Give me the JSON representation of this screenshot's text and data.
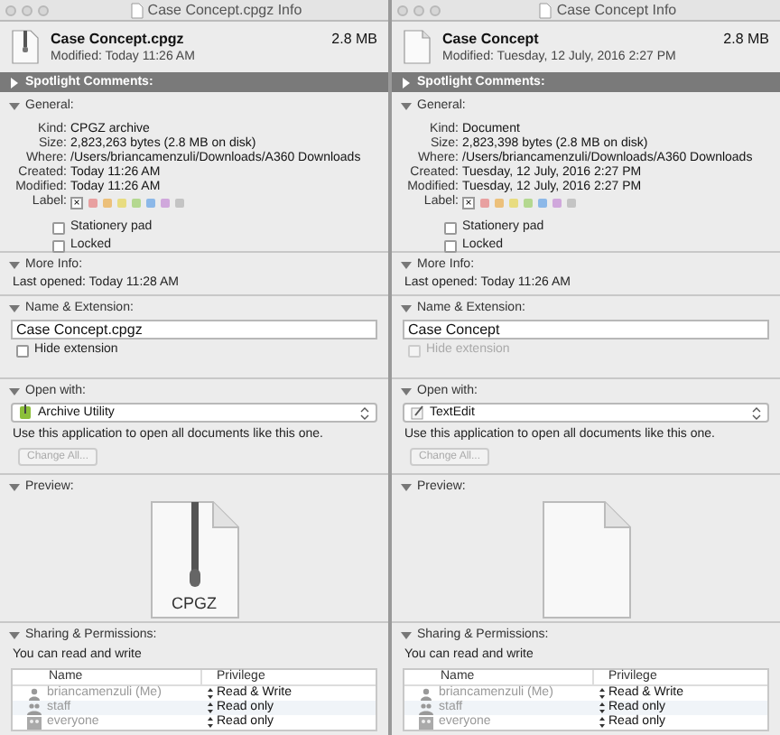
{
  "windows": [
    {
      "title": "Case Concept.cpgz Info",
      "file": {
        "name": "Case Concept.cpgz",
        "size": "2.8 MB",
        "modified": "Modified: Today 11:26 AM",
        "kind": "archive"
      },
      "spotlight": {
        "label": "Spotlight Comments:",
        "expanded": false
      },
      "general": {
        "label": "General:",
        "expanded": true,
        "fields": [
          {
            "key": "Kind:",
            "value": "CPGZ archive"
          },
          {
            "key": "Size:",
            "value": "2,823,263 bytes (2.8 MB on disk)"
          },
          {
            "key": "Where:",
            "value": "/Users/briancamenzuli/Downloads/A360 Downloads"
          },
          {
            "key": "Created:",
            "value": "Today 11:26 AM"
          },
          {
            "key": "Modified:",
            "value": "Today 11:26 AM"
          }
        ],
        "label_key": "Label:",
        "label_none": "×",
        "label_colors": [
          {
            "color": "#e8a0a0"
          },
          {
            "color": "#ecc07a"
          },
          {
            "color": "#e8dc80"
          },
          {
            "color": "#b4d890"
          },
          {
            "color": "#8cb8e8"
          },
          {
            "color": "#d0a8dc"
          },
          {
            "color": "#c4c4c4"
          }
        ],
        "stationery": {
          "label": "Stationery pad",
          "checked": false
        },
        "locked": {
          "label": "Locked",
          "checked": false
        }
      },
      "more_info": {
        "label": "More Info:",
        "expanded": true,
        "last_opened": "Last opened: Today 11:28 AM"
      },
      "name_ext": {
        "label": "Name & Extension:",
        "expanded": true,
        "value": "Case Concept.cpgz",
        "hide_extension": {
          "label": "Hide extension",
          "checked": false,
          "disabled": false
        }
      },
      "open_with": {
        "label": "Open with:",
        "expanded": true,
        "app": {
          "kind": "archive",
          "label": "Archive Utility"
        },
        "note": "Use this application to open all documents like this one.",
        "button": {
          "label": "Change All...",
          "disabled": true
        }
      },
      "preview": {
        "label": "Preview:",
        "expanded": true,
        "kind": "archive",
        "badge": "CPGZ"
      },
      "sharing": {
        "label": "Sharing & Permissions:",
        "expanded": true,
        "note": "You can read and write",
        "columns": [
          "Name",
          "Privilege"
        ],
        "rows": [
          {
            "kind": "user",
            "name": "briancamenzuli (Me)",
            "privilege": "Read & Write"
          },
          {
            "kind": "group",
            "name": "staff",
            "privilege": "Read only"
          },
          {
            "kind": "everyone",
            "name": "everyone",
            "privilege": "Read only"
          }
        ]
      }
    },
    {
      "title": "Case Concept Info",
      "file": {
        "name": "Case Concept",
        "size": "2.8 MB",
        "modified": "Modified: Tuesday, 12 July, 2016 2:27 PM",
        "kind": "document"
      },
      "spotlight": {
        "label": "Spotlight Comments:",
        "expanded": false
      },
      "general": {
        "label": "General:",
        "expanded": true,
        "fields": [
          {
            "key": "Kind:",
            "value": "Document"
          },
          {
            "key": "Size:",
            "value": "2,823,398 bytes (2.8 MB on disk)"
          },
          {
            "key": "Where:",
            "value": "/Users/briancamenzuli/Downloads/A360 Downloads"
          },
          {
            "key": "Created:",
            "value": "Tuesday, 12 July, 2016 2:27 PM"
          },
          {
            "key": "Modified:",
            "value": "Tuesday, 12 July, 2016 2:27 PM"
          }
        ],
        "label_key": "Label:",
        "label_none": "×",
        "label_colors": [
          {
            "color": "#e8a0a0"
          },
          {
            "color": "#ecc07a"
          },
          {
            "color": "#e8dc80"
          },
          {
            "color": "#b4d890"
          },
          {
            "color": "#8cb8e8"
          },
          {
            "color": "#d0a8dc"
          },
          {
            "color": "#c4c4c4"
          }
        ],
        "stationery": {
          "label": "Stationery pad",
          "checked": false
        },
        "locked": {
          "label": "Locked",
          "checked": false
        }
      },
      "more_info": {
        "label": "More Info:",
        "expanded": true,
        "last_opened": "Last opened: Today 11:26 AM"
      },
      "name_ext": {
        "label": "Name & Extension:",
        "expanded": true,
        "value": "Case Concept",
        "hide_extension": {
          "label": "Hide extension",
          "checked": false,
          "disabled": true
        }
      },
      "open_with": {
        "label": "Open with:",
        "expanded": true,
        "app": {
          "kind": "pen",
          "label": "TextEdit"
        },
        "note": "Use this application to open all documents like this one.",
        "button": {
          "label": "Change All...",
          "disabled": true
        }
      },
      "preview": {
        "label": "Preview:",
        "expanded": true,
        "kind": "document"
      },
      "sharing": {
        "label": "Sharing & Permissions:",
        "expanded": true,
        "note": "You can read and write",
        "columns": [
          "Name",
          "Privilege"
        ],
        "rows": [
          {
            "kind": "user",
            "name": "briancamenzuli (Me)",
            "privilege": "Read & Write"
          },
          {
            "kind": "group",
            "name": "staff",
            "privilege": "Read only"
          },
          {
            "kind": "everyone",
            "name": "everyone",
            "privilege": "Read only"
          }
        ]
      }
    }
  ]
}
